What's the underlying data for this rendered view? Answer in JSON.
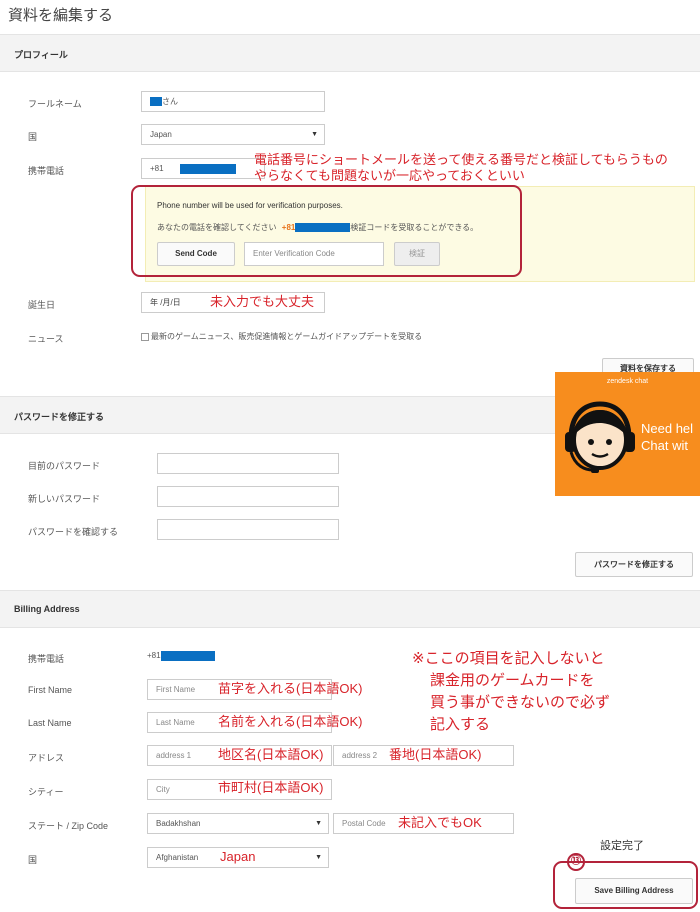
{
  "page": {
    "title": "資料を編集する"
  },
  "profile": {
    "header": "プロフィール",
    "full_name_label": "フールネーム",
    "full_name_value": "さん",
    "country_label": "国",
    "country_value": "Japan",
    "phone_label": "携帯電話",
    "phone_prefix": "+81",
    "verify_notice": "Phone number will be used for verification purposes.",
    "verify_text_pre": "あなたの電話を確認してください",
    "verify_phone": "+81",
    "verify_text_post": "検証コードを受取ることができる。",
    "send_code_label": "Send Code",
    "code_placeholder": "Enter Verification Code",
    "verify_label": "検証",
    "birthday_label": "誕生日",
    "birthday_placeholder": "年 /月/日",
    "news_label": "ニュース",
    "news_checkbox_text": "最新のゲームニュース、販売促進情報とゲームガイドアップデートを受取る",
    "save_label": "資料を保存する"
  },
  "password": {
    "header": "パスワードを修正する",
    "current_label": "目前のパスワード",
    "new_label": "新しいパスワード",
    "confirm_label": "パスワードを確認する",
    "submit_label": "パスワードを修正する"
  },
  "billing": {
    "header": "Billing Address",
    "phone_label": "携帯電話",
    "phone_prefix": "+81",
    "first_name_label": "First Name",
    "first_name_placeholder": "First Name",
    "last_name_label": "Last Name",
    "last_name_placeholder": "Last Name",
    "address_label": "アドレス",
    "address1_placeholder": "address 1",
    "address2_placeholder": "address 2",
    "city_label": "シティー",
    "city_placeholder": "City",
    "state_label": "ステート / Zip Code",
    "state_value": "Badakhshan",
    "postal_placeholder": "Postal Code",
    "country_label": "国",
    "country_value": "Afghanistan",
    "save_label": "Save Billing Address"
  },
  "annotations": {
    "phone_note_1": "電話番号にショートメールを送って使える番号だと検証してもらうもの",
    "phone_note_2": "やらなくても問題ないが一応やっておくといい",
    "birthday_note": "未入力でも大丈夫",
    "billing_note_1": "※ここの項目を記入しないと",
    "billing_note_2": "課金用のゲームカードを",
    "billing_note_3": "買う事ができないので必ず",
    "billing_note_4": "記入する",
    "first_name_note": "苗字を入れる(日本語OK)",
    "last_name_note": "名前を入れる(日本語OK)",
    "address1_note": "地区名(日本語OK)",
    "address2_note": "番地(日本語OK)",
    "city_note": "市町村(日本語OK)",
    "postal_note": "未記入でもOK",
    "country_note": "Japan",
    "done_note": "設定完了",
    "step_number": "⑬"
  },
  "zendesk": {
    "title": "zendesk chat",
    "line1": "Need hel",
    "line2": "Chat wit"
  },
  "colors": {
    "annotation_red": "#d8232a",
    "frame_red": "#b3233a",
    "redaction_blue": "#0a6fc2",
    "zendesk_orange": "#f78d1e",
    "verify_orange": "#e8731b"
  },
  "icons": {
    "select_arrow": "chevron-down-icon",
    "chat_agent": "headset-agent-icon"
  }
}
